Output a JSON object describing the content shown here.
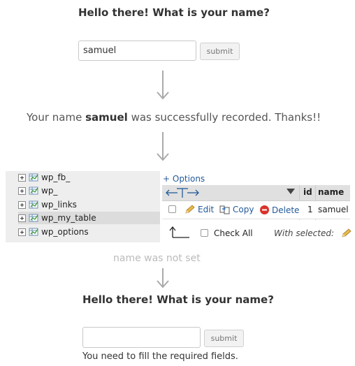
{
  "step1": {
    "heading": "Hello there! What is your name?",
    "input_value": "samuel",
    "submit_label": "submit"
  },
  "step2": {
    "message_prefix": "Your name ",
    "message_name": "samuel",
    "message_suffix": " was successfully recorded. Thanks!!"
  },
  "phpmyadmin": {
    "tables": [
      {
        "label": "wp_fb_"
      },
      {
        "label": "wp_"
      },
      {
        "label": "wp_links"
      },
      {
        "label": "wp_my_table"
      },
      {
        "label": "wp_options"
      }
    ],
    "options_link": "+ Options",
    "columns": [
      "id",
      "name"
    ],
    "row": {
      "edit_label": "Edit",
      "copy_label": "Copy",
      "delete_label": "Delete",
      "id": "1",
      "name": "samuel"
    },
    "check_all_label": "Check All",
    "with_selected_label": "With selected:"
  },
  "note": "name was not set",
  "step3": {
    "heading": "Hello there! What is your name?",
    "input_value": "",
    "submit_label": "submit",
    "error_message": "You need to fill the required fields."
  },
  "colors": {
    "link": "#235a9a",
    "delete_icon": "#d9342b",
    "muted": "#bbbbbb"
  }
}
